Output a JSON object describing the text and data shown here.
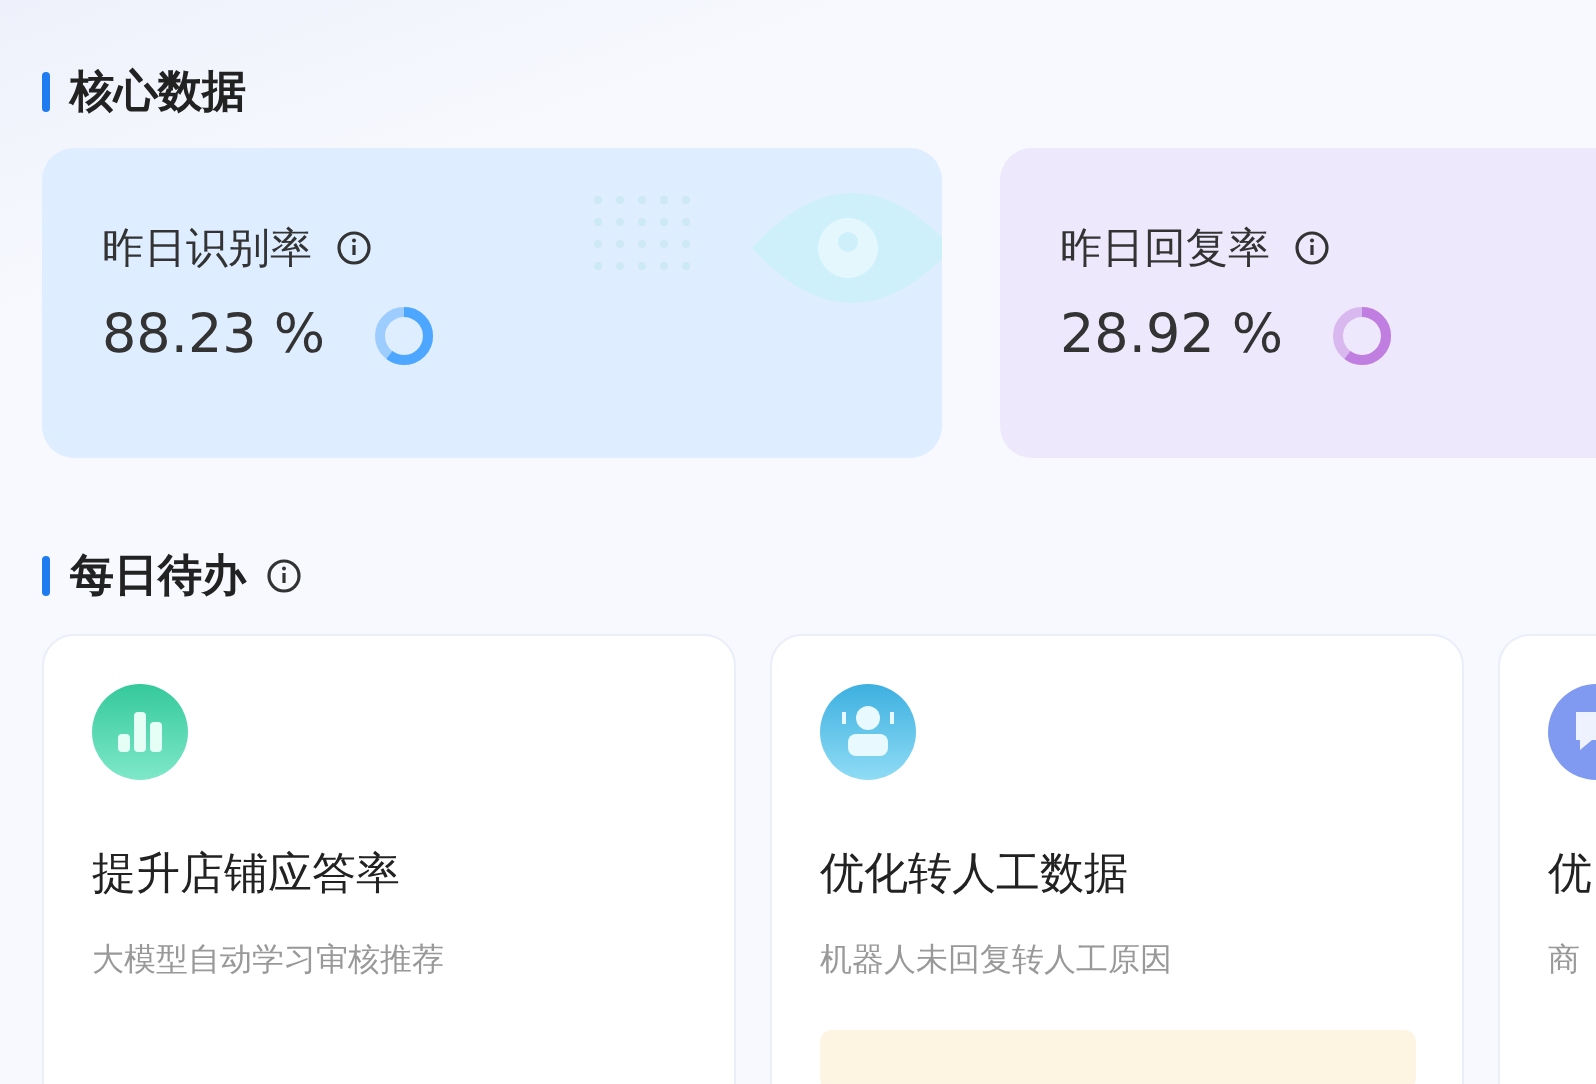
{
  "core_section": {
    "title": "核心数据",
    "metrics": [
      {
        "label": "昨日识别率",
        "value": "88.23 %",
        "color": "#4da6ff"
      },
      {
        "label": "昨日回复率",
        "value": "28.92 %",
        "color": "#c07ee0"
      }
    ]
  },
  "todo_section": {
    "title": "每日待办",
    "tasks": [
      {
        "title": "提升店铺应答率",
        "description": "大模型自动学习审核推荐",
        "kind": "chart",
        "notice": false
      },
      {
        "title": "优化转人工数据",
        "description": "机器人未回复转人工原因",
        "kind": "agent",
        "notice": true
      },
      {
        "title": "优",
        "description": "商",
        "kind": "chat",
        "notice": false
      }
    ]
  }
}
